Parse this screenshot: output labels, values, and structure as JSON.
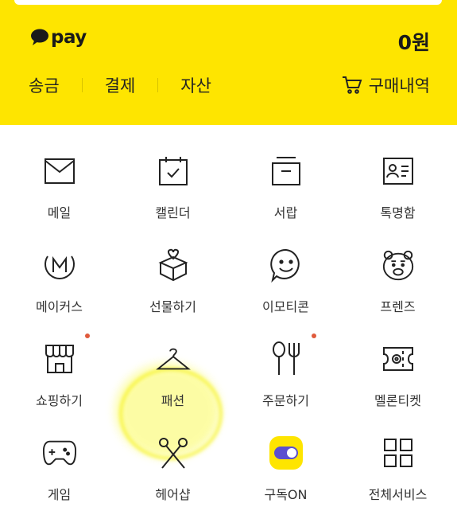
{
  "pay": {
    "logo_text": "pay",
    "balance": "0원",
    "nav": [
      "송금",
      "결제",
      "자산"
    ],
    "history_label": "구매내역",
    "bg_color": "#fee500"
  },
  "services": [
    {
      "label": "메일",
      "icon": "mail-icon"
    },
    {
      "label": "캘린더",
      "icon": "calendar-icon"
    },
    {
      "label": "서랍",
      "icon": "drawer-icon"
    },
    {
      "label": "톡명함",
      "icon": "id-card-icon"
    },
    {
      "label": "메이커스",
      "icon": "makers-icon"
    },
    {
      "label": "선물하기",
      "icon": "gift-icon",
      "highlighted": true
    },
    {
      "label": "이모티콘",
      "icon": "emoticon-icon"
    },
    {
      "label": "프렌즈",
      "icon": "friends-bear-icon"
    },
    {
      "label": "쇼핑하기",
      "icon": "shop-icon",
      "badge": true
    },
    {
      "label": "패션",
      "icon": "hanger-icon"
    },
    {
      "label": "주문하기",
      "icon": "fork-spoon-icon",
      "badge": true
    },
    {
      "label": "멜론티켓",
      "icon": "ticket-icon"
    },
    {
      "label": "게임",
      "icon": "gamepad-icon"
    },
    {
      "label": "헤어샵",
      "icon": "scissors-icon"
    },
    {
      "label": "구독ON",
      "icon": "subscription-toggle-icon"
    },
    {
      "label": "전체서비스",
      "icon": "grid-icon"
    }
  ]
}
